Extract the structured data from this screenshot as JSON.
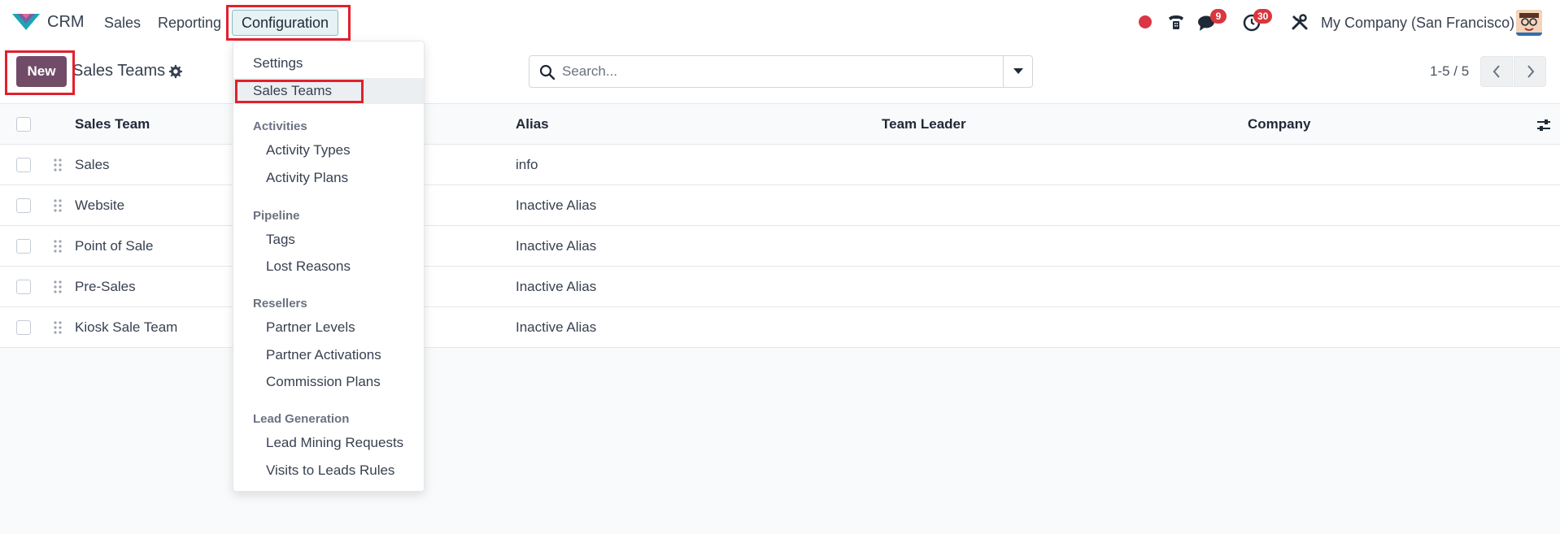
{
  "app": {
    "name": "CRM",
    "brand_color": "#714b67",
    "logo_icon": "crm-logo-icon"
  },
  "nav": {
    "items": [
      {
        "label": "Sales"
      },
      {
        "label": "Reporting"
      },
      {
        "label": "Configuration"
      }
    ]
  },
  "systray": {
    "chat_count": "9",
    "activity_count": "30",
    "company": "My Company (San Francisco)"
  },
  "control_panel": {
    "new_label": "New",
    "title": "Sales Teams",
    "search_placeholder": "Search...",
    "pager": "1-5 / 5"
  },
  "table": {
    "columns": [
      "Sales Team",
      "Alias",
      "Team Leader",
      "Company"
    ],
    "rows": [
      {
        "team": "Sales",
        "alias": "info",
        "leader": "",
        "company": ""
      },
      {
        "team": "Website",
        "alias": "Inactive Alias",
        "leader": "",
        "company": ""
      },
      {
        "team": "Point of Sale",
        "alias": "Inactive Alias",
        "leader": "",
        "company": ""
      },
      {
        "team": "Pre-Sales",
        "alias": "Inactive Alias",
        "leader": "",
        "company": ""
      },
      {
        "team": "Kiosk Sale Team",
        "alias": "Inactive Alias",
        "leader": "",
        "company": ""
      }
    ]
  },
  "dropdown": {
    "settings": "Settings",
    "sales_teams": "Sales Teams",
    "activities_header": "Activities",
    "activity_types": "Activity Types",
    "activity_plans": "Activity Plans",
    "pipeline_header": "Pipeline",
    "tags": "Tags",
    "lost_reasons": "Lost Reasons",
    "resellers_header": "Resellers",
    "partner_levels": "Partner Levels",
    "partner_activations": "Partner Activations",
    "commission_plans": "Commission Plans",
    "lead_generation_header": "Lead Generation",
    "lead_mining_requests": "Lead Mining Requests",
    "visits_to_leads_rules": "Visits to Leads Rules"
  },
  "colors": {
    "highlight": "#e0212d",
    "badge": "#d9363e",
    "record_dot": "#dc3545"
  }
}
